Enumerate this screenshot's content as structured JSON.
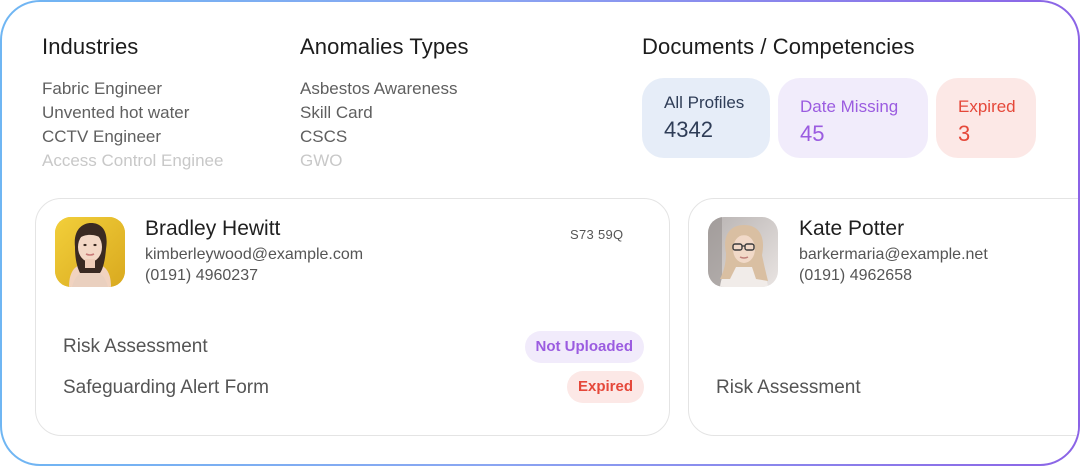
{
  "industries": {
    "title": "Industries",
    "items": [
      "Fabric Engineer",
      "Unvented hot water",
      "CCTV Engineer",
      "Access Control Enginee"
    ]
  },
  "anomalies": {
    "title": "Anomalies Types",
    "items": [
      "Asbestos Awareness",
      "Skill Card",
      "CSCS",
      "GWO"
    ]
  },
  "documents": {
    "title": "Documents / Competencies",
    "stats": [
      {
        "label": "All Profiles",
        "value": "4342",
        "color": "#2f3d57"
      },
      {
        "label": "Date Missing",
        "value": "45",
        "color": "#9b5ce0"
      },
      {
        "label": "Expired",
        "value": "3",
        "color": "#e5483a"
      }
    ]
  },
  "profiles": [
    {
      "name": "Bradley Hewitt",
      "email": "kimberleywood@example.com",
      "phone": "(0191) 4960237",
      "postcode": "S73 59Q",
      "avatar": "woman-yellow-background-photo",
      "documents": [
        {
          "label": "Risk Assessment",
          "status": "Not Uploaded"
        },
        {
          "label": "Safeguarding Alert Form",
          "status": "Expired"
        }
      ]
    },
    {
      "name": "Kate Potter",
      "email": "barkermaria@example.net",
      "phone": "(0191) 4962658",
      "avatar": "woman-glasses-photo",
      "documents": [
        {
          "label": "Risk Assessment"
        }
      ]
    }
  ]
}
